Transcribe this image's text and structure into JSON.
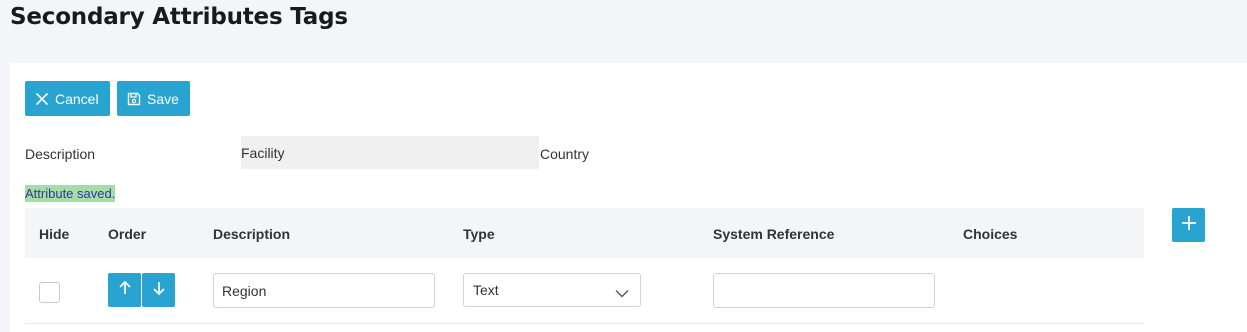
{
  "page": {
    "title": "Secondary Attributes Tags"
  },
  "toolbar": {
    "cancel_label": "Cancel",
    "save_label": "Save"
  },
  "form": {
    "description_label": "Description",
    "description_value": "Facility",
    "country_label": "Country"
  },
  "alert": {
    "message": "Attribute saved."
  },
  "table": {
    "headers": {
      "hide": "Hide",
      "order": "Order",
      "description": "Description",
      "type": "Type",
      "system_reference": "System Reference",
      "choices": "Choices"
    },
    "rows": [
      {
        "hide": false,
        "description": "Region",
        "type": "Text",
        "system_reference": ""
      }
    ]
  },
  "icons": {
    "cancel": "close-icon",
    "save": "floppy-disk-icon",
    "up": "arrow-up-icon",
    "down": "arrow-down-icon",
    "select": "chevron-down-icon",
    "add": "plus-icon"
  },
  "colors": {
    "accent": "#29a3cf",
    "alert_bg": "#a9dba9",
    "alert_text": "#2b3a9b"
  }
}
